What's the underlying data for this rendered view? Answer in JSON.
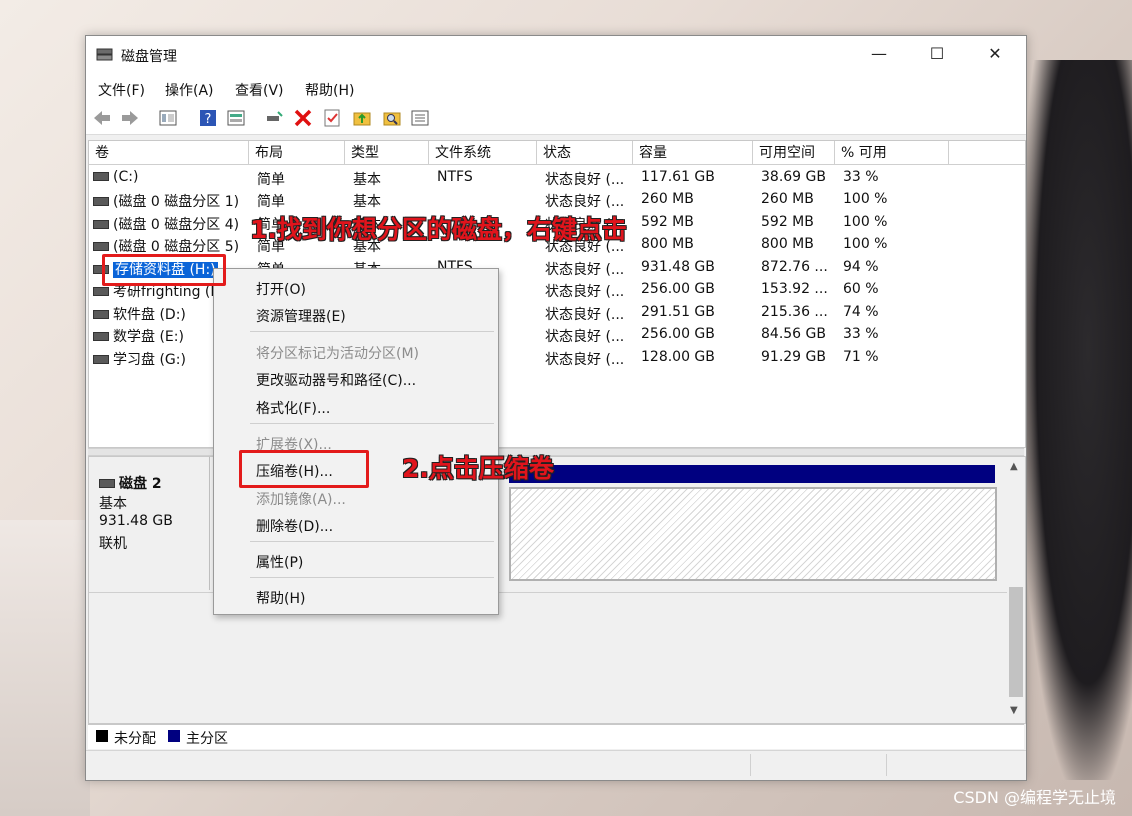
{
  "window": {
    "title": "磁盘管理",
    "controls": {
      "minimize": "—",
      "maximize": "☐",
      "close": "✕"
    }
  },
  "menu": [
    "文件(F)",
    "操作(A)",
    "查看(V)",
    "帮助(H)"
  ],
  "toolbar_icons": [
    "back-arrow-icon",
    "forward-arrow-icon",
    "properties-icon",
    "help-icon",
    "view-icon",
    "connect-icon",
    "delete-icon",
    "check-icon",
    "up-folder-icon",
    "search-icon",
    "list-icon"
  ],
  "columns": [
    "卷",
    "布局",
    "类型",
    "文件系统",
    "状态",
    "容量",
    "可用空间",
    "% 可用"
  ],
  "volumes": [
    {
      "name": "(C:)",
      "layout": "简单",
      "type": "基本",
      "fs": "NTFS",
      "status": "状态良好 (...",
      "capacity": "117.61 GB",
      "free": "38.69 GB",
      "pct": "33 %"
    },
    {
      "name": "(磁盘 0 磁盘分区 1)",
      "layout": "简单",
      "type": "基本",
      "fs": "",
      "status": "状态良好 (...",
      "capacity": "260 MB",
      "free": "260 MB",
      "pct": "100 %"
    },
    {
      "name": "(磁盘 0 磁盘分区 4)",
      "layout": "简单",
      "type": "基本",
      "fs": "",
      "status": "状态良好 (...",
      "capacity": "592 MB",
      "free": "592 MB",
      "pct": "100 %"
    },
    {
      "name": "(磁盘 0 磁盘分区 5)",
      "layout": "简单",
      "type": "基本",
      "fs": "",
      "status": "状态良好 (...",
      "capacity": "800 MB",
      "free": "800 MB",
      "pct": "100 %"
    },
    {
      "name": "存储资料盘 (H:)",
      "layout": "简单",
      "type": "基本",
      "fs": "NTFS",
      "status": "状态良好 (...",
      "capacity": "931.48 GB",
      "free": "872.76 ...",
      "pct": "94 %"
    },
    {
      "name": "考研frighting (I",
      "layout": "",
      "type": "",
      "fs": "",
      "status": "状态良好 (...",
      "capacity": "256.00 GB",
      "free": "153.92 ...",
      "pct": "60 %"
    },
    {
      "name": "软件盘 (D:)",
      "layout": "",
      "type": "",
      "fs": "",
      "status": "状态良好 (...",
      "capacity": "291.51 GB",
      "free": "215.36 ...",
      "pct": "74 %"
    },
    {
      "name": "数学盘 (E:)",
      "layout": "",
      "type": "",
      "fs": "",
      "status": "状态良好 (...",
      "capacity": "256.00 GB",
      "free": "84.56 GB",
      "pct": "33 %"
    },
    {
      "name": "学习盘 (G:)",
      "layout": "",
      "type": "",
      "fs": "",
      "status": "状态良好 (...",
      "capacity": "128.00 GB",
      "free": "91.29 GB",
      "pct": "71 %"
    }
  ],
  "disk": {
    "name": "磁盘 2",
    "kind": "基本",
    "size": "931.48 GB",
    "state": "联机"
  },
  "context_menu": [
    {
      "label": "打开(O)",
      "enabled": true
    },
    {
      "label": "资源管理器(E)",
      "enabled": true
    },
    {
      "label": "将分区标记为活动分区(M)",
      "enabled": false
    },
    {
      "label": "更改驱动器号和路径(C)...",
      "enabled": true
    },
    {
      "label": "格式化(F)...",
      "enabled": true
    },
    {
      "label": "扩展卷(X)...",
      "enabled": false
    },
    {
      "label": "压缩卷(H)...",
      "enabled": true
    },
    {
      "label": "添加镜像(A)...",
      "enabled": false
    },
    {
      "label": "删除卷(D)...",
      "enabled": true
    },
    {
      "label": "属性(P)",
      "enabled": true
    },
    {
      "label": "帮助(H)",
      "enabled": true
    }
  ],
  "legend": {
    "unallocated": "未分配",
    "primary": "主分区",
    "unallocated_color": "#000000",
    "primary_color": "#000080"
  },
  "annotations": {
    "step1": "1.找到你想分区的磁盘，右键点击",
    "step2": "2.点击压缩卷"
  },
  "watermark": "CSDN @编程学无止境",
  "colors": {
    "selection": "#0a64d8",
    "annotation_red": "#e31b1b",
    "partition_blue": "#000080"
  }
}
